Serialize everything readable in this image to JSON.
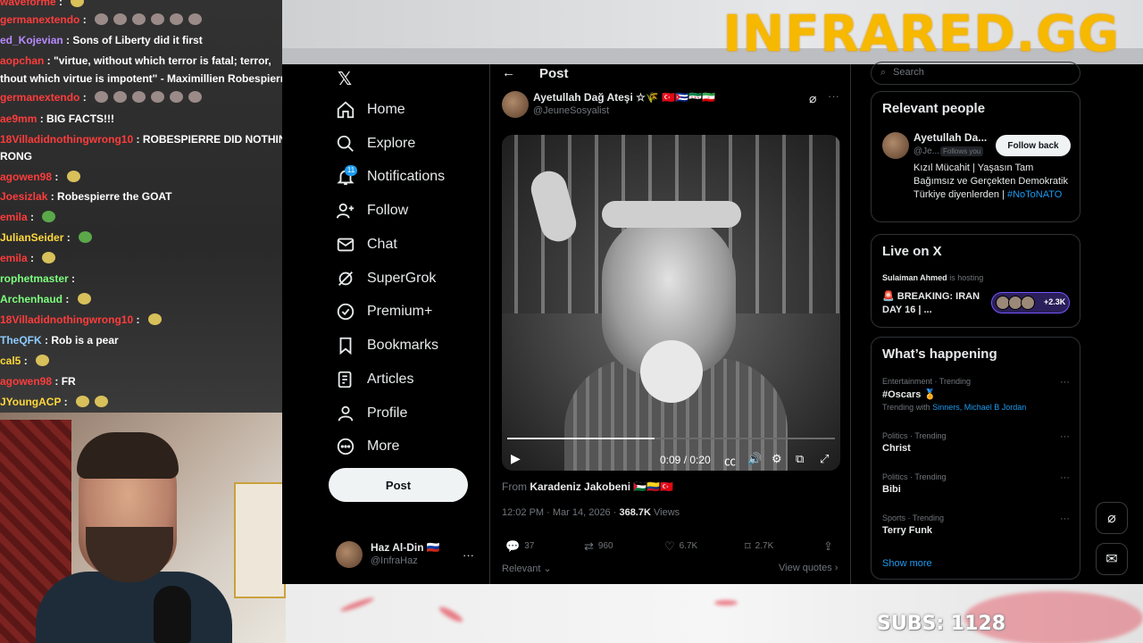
{
  "overlay": {
    "brand": "INFRARED.GG",
    "subs": "SUBS: 1128",
    "colors": {
      "brand": "#f7b800",
      "chat_name": "#ff3c3c",
      "link": "#1d9bf0"
    }
  },
  "chat": [
    {
      "user": "waveforme",
      "msg": "",
      "emote": "yellow"
    },
    {
      "user": "germanextendo",
      "msg": "",
      "emote": "grey-row"
    },
    {
      "user": "ed_Kojevian",
      "msg": "Sons of Liberty did it first"
    },
    {
      "user": "aopchan",
      "msg": "\"virtue, without which terror is fatal; terror,"
    },
    {
      "user": "",
      "msg": "thout which virtue is impotent\" - Maximillien Robespierre"
    },
    {
      "user": "germanextendo",
      "msg": "",
      "emote": "grey-row"
    },
    {
      "user": "ae9mm",
      "msg": "BIG FACTS!!!"
    },
    {
      "user": "18Villadidnothingwrong10",
      "msg": "ROBESPIERRE DID NOTHING"
    },
    {
      "user": "",
      "msg": "RONG"
    },
    {
      "user": "agowen98",
      "msg": "",
      "emote": "yellow"
    },
    {
      "user": "Joesizlak",
      "msg": "Robespierre the GOAT"
    },
    {
      "user": "emila",
      "msg": "",
      "emote": "green"
    },
    {
      "user": "JulianSeider",
      "msg": "",
      "emote": "green"
    },
    {
      "user": "emila",
      "msg": "",
      "emote": "yellow"
    },
    {
      "user": "rophetmaster",
      "msg": ""
    },
    {
      "user": "Archenhaud",
      "msg": "",
      "emote": "yellow"
    },
    {
      "user": "18Villadidnothingwrong10",
      "msg": "",
      "emote": "yellow"
    },
    {
      "user": "TheQFK",
      "msg": "Rob is a pear"
    },
    {
      "user": "cal5",
      "msg": "",
      "emote": "yellow"
    },
    {
      "user": "agowen98",
      "msg": "FR"
    },
    {
      "user": "JYoungACP",
      "msg": "",
      "emote": "yellow2"
    }
  ],
  "x": {
    "nav": [
      {
        "label": "Home"
      },
      {
        "label": "Explore"
      },
      {
        "label": "Notifications"
      },
      {
        "label": "Follow"
      },
      {
        "label": "Chat"
      },
      {
        "label": "SuperGrok"
      },
      {
        "label": "Premium+"
      },
      {
        "label": "Bookmarks"
      },
      {
        "label": "Articles"
      },
      {
        "label": "Profile"
      },
      {
        "label": "More"
      }
    ],
    "notif_count": "11",
    "post_button": "Post",
    "account": {
      "name": "Haz Al-Din 🇷🇺",
      "handle": "@InfraHaz"
    },
    "header_title": "Post",
    "post": {
      "author_name": "Ayetullah Dağ Ateşi ☆🌾 🇹🇷🇨🇺🇸🇾🇮🇷",
      "author_handle": "@JeuneSosyalist",
      "video_time": "0:09 / 0:20",
      "video_progress": 0.45,
      "from_label": "From",
      "from_name": "Karadeniz Jakobeni 🇵🇸🇨🇴🇹🇷",
      "timestamp": "12:02 PM · Mar 14, 2026 · ",
      "views_count": "368.7K",
      "views_label": "Views",
      "replies": "37",
      "reposts": "960",
      "likes": "6.7K",
      "bookmarks": "2.7K",
      "sort": "Relevant",
      "view_quotes": "View quotes"
    },
    "search_placeholder": "Search",
    "relevant_people": {
      "title": "Relevant people",
      "name": "Ayetullah Da...",
      "handle": "@Je...",
      "follows_you": "Follows you",
      "follow_back": "Follow back",
      "bio": "Kızıl Mücahit | Yaşasın Tam Bağımsız ve Gerçekten Demokratik Türkiye diyenlerden | ",
      "bio_tag": "#NoToNATO"
    },
    "live": {
      "title": "Live on X",
      "host": "Sulaiman Ahmed",
      "host_suffix": " is hosting",
      "stream_title": "🚨 BREAKING: IRAN DAY 16 | ...",
      "listeners": "+2.3K"
    },
    "happening": {
      "title": "What’s happening",
      "trends": [
        {
          "meta": "Entertainment · Trending",
          "name": "#Oscars 🏅",
          "with_label": "Trending with ",
          "with": "Sinners, Michael B Jordan"
        },
        {
          "meta": "Politics · Trending",
          "name": "Christ"
        },
        {
          "meta": "Politics · Trending",
          "name": "Bibi"
        },
        {
          "meta": "Sports · Trending",
          "name": "Terry Funk"
        }
      ],
      "show_more": "Show more"
    }
  }
}
